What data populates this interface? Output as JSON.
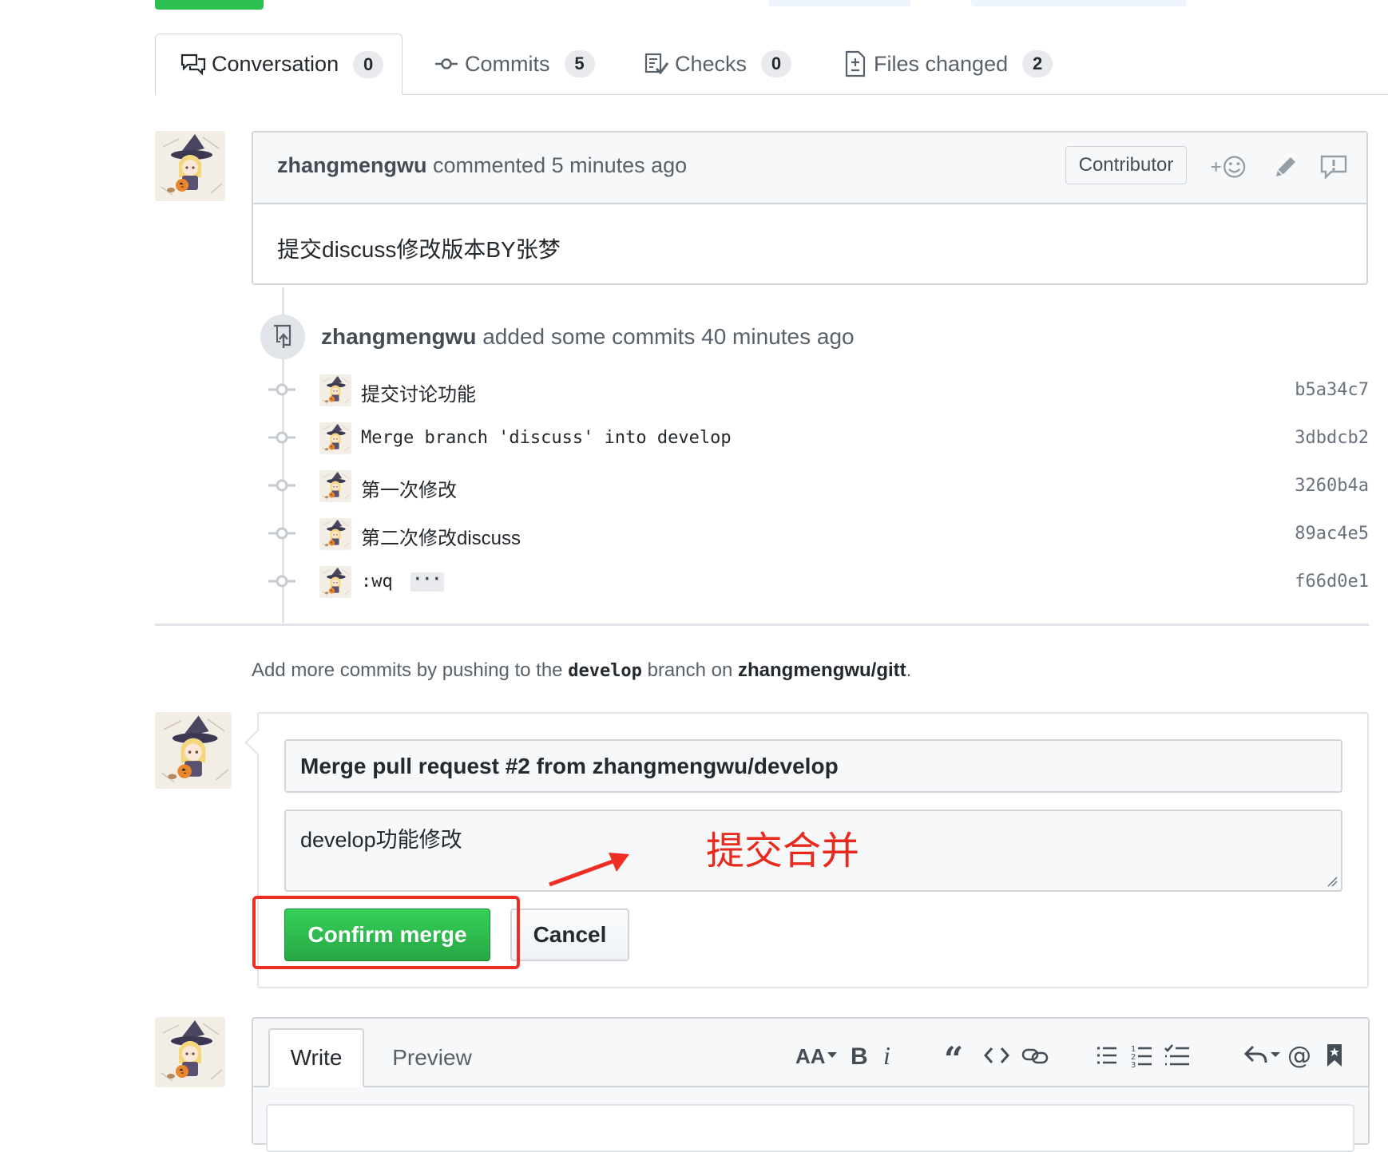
{
  "tabs": [
    {
      "label": "Conversation",
      "count": "0",
      "icon": "comment-discussion-icon"
    },
    {
      "label": "Commits",
      "count": "5",
      "icon": "git-commit-icon"
    },
    {
      "label": "Checks",
      "count": "0",
      "icon": "checklist-icon"
    },
    {
      "label": "Files changed",
      "count": "2",
      "icon": "file-diff-icon"
    }
  ],
  "comment": {
    "author": "zhangmengwu",
    "action": "commented 5 minutes ago",
    "badge": "Contributor",
    "body": "提交discuss修改版本BY张梦"
  },
  "timeline": {
    "author": "zhangmengwu",
    "action": "added some commits 40 minutes ago",
    "commits": [
      {
        "message": "提交讨论功能",
        "sha": "b5a34c7"
      },
      {
        "message": "Merge branch 'discuss' into develop",
        "sha": "3dbdcb2"
      },
      {
        "message": "第一次修改",
        "sha": "3260b4a"
      },
      {
        "message": "第二次修改discuss",
        "sha": "89ac4e5"
      },
      {
        "message": ":wq",
        "sha": "f66d0e1",
        "ellipsis": "···"
      }
    ]
  },
  "push_note": {
    "prefix": "Add more commits by pushing to the",
    "branch": "develop",
    "middle": "branch on",
    "repo": "zhangmengwu/gitt",
    "suffix": "."
  },
  "merge": {
    "title_value": "Merge pull request #2 from zhangmengwu/develop",
    "body_value": "develop功能修改",
    "confirm_label": "Confirm merge",
    "cancel_label": "Cancel",
    "annotation": "提交合并",
    "annotation_color": "#e8291c"
  },
  "editor": {
    "write_tab": "Write",
    "preview_tab": "Preview",
    "toolbar": [
      "text-size-icon",
      "bold-icon",
      "italic-icon",
      "quote-icon",
      "code-icon",
      "link-icon",
      "unordered-list-icon",
      "ordered-list-icon",
      "task-list-icon",
      "reply-icon",
      "mention-icon",
      "bookmark-icon"
    ]
  },
  "colors": {
    "green": "#28a745",
    "border": "#d1d5da",
    "annotation_red": "#ee2e24"
  }
}
